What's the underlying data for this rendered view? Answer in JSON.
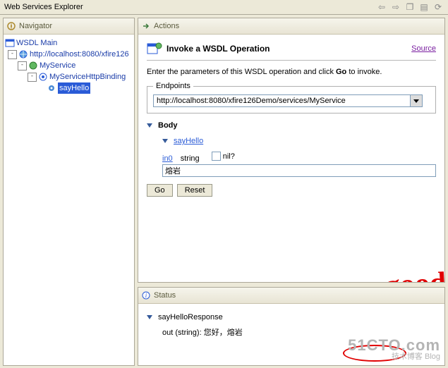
{
  "window": {
    "title": "Web Services Explorer"
  },
  "navigator": {
    "title": "Navigator",
    "root_label": "WSDL Main",
    "url_label": "http://localhost:8080/xfire126",
    "service_label": "MyService",
    "binding_label": "MyServiceHttpBinding",
    "op_label": "sayHello"
  },
  "actions": {
    "title": "Actions",
    "op_title": "Invoke a WSDL Operation",
    "source": "Source",
    "desc_pre": "Enter the parameters of this WSDL operation and click ",
    "desc_go": "Go",
    "desc_post": " to invoke.",
    "endpoints_legend": "Endpoints",
    "endpoint_value": "http://localhost:8080/xfire126Demo/services/MyService",
    "body_label": "Body",
    "op_name": "sayHello",
    "param_name": "in0",
    "param_type": "string",
    "nil_label": "nil?",
    "input_value": "熔岩",
    "go_btn": "Go",
    "reset_btn": "Reset"
  },
  "status": {
    "title": "Status",
    "resp_name": "sayHelloResponse",
    "out_label": "out (string):",
    "out_value": "您好，熔岩"
  },
  "annotation": {
    "good": "good!"
  },
  "watermark": {
    "big": "51CTO.com",
    "small": "技术博客 Blog"
  }
}
